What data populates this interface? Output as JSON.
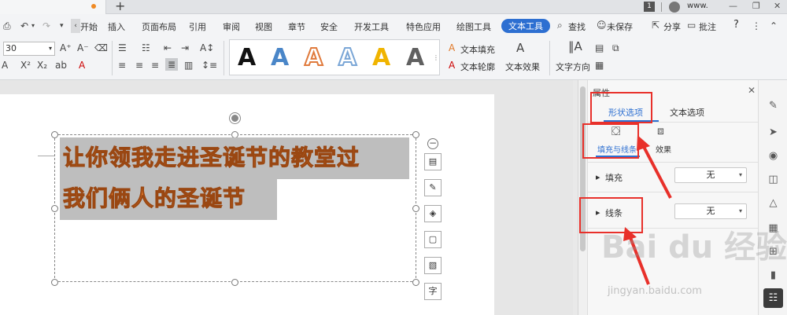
{
  "titlebar": {
    "badge": "1",
    "user": "www."
  },
  "menu": {
    "items": [
      "开始",
      "插入",
      "页面布局",
      "引用",
      "审阅",
      "视图",
      "章节",
      "安全",
      "开发工具",
      "特色应用",
      "绘图工具",
      "文本工具"
    ],
    "search": "查找",
    "unsaved": "未保存",
    "share": "分享",
    "comment": "批注",
    "help": "?"
  },
  "ribbon": {
    "font_size": "30",
    "style_glyph": "A",
    "gallery_colors": [
      "#111111",
      "#4a86c8",
      "#e07a3c",
      "#7aa6d6",
      "#f0b400",
      "#606060"
    ],
    "text_fill": "文本填充",
    "text_outline": "文本轮廓",
    "text_effect": "文本效果",
    "text_direction": "文字方向"
  },
  "document": {
    "line1": "让你领我走进圣诞节的教堂过",
    "line2": "我们俩人的圣诞节",
    "float_tool_text": "字"
  },
  "panel": {
    "title": "属性",
    "tab_shape": "形状选项",
    "tab_text": "文本选项",
    "sub_fill_line": "填充与线条",
    "sub_effect": "效果",
    "fill_label": "填充",
    "fill_value": "无",
    "line_label": "线条",
    "line_value": "无"
  },
  "watermark": {
    "logo": "Bai du 经验",
    "url": "jingyan.baidu.com"
  },
  "colors": {
    "accent": "#2d6fd1",
    "text_orange": "#e07828",
    "annotation_red": "#e8302a"
  }
}
